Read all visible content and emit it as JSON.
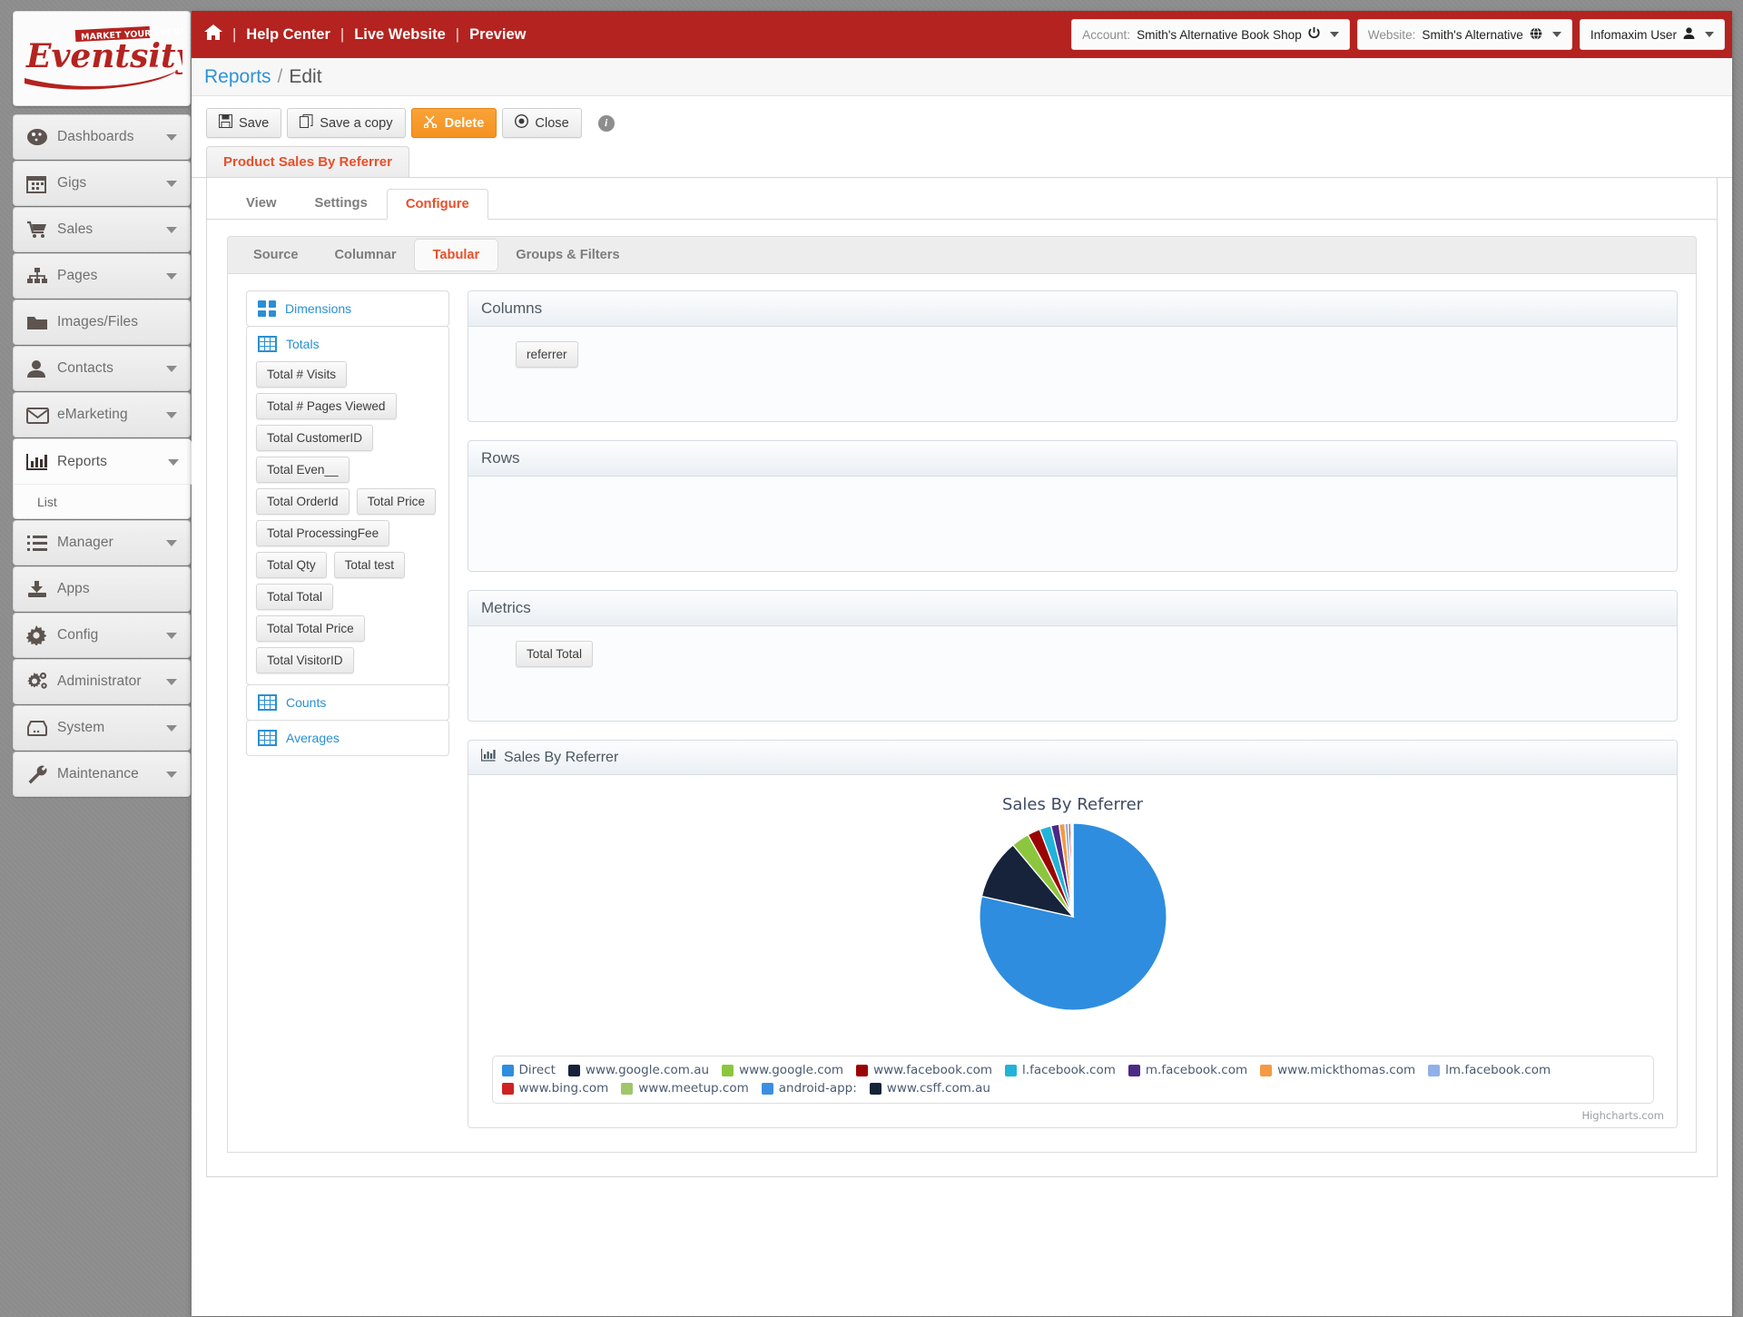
{
  "brand": {
    "logo_top": "MARKET YOUR EVENT",
    "logo_main": "Eventsity",
    "accent": "#b4231f"
  },
  "topbar": {
    "home_icon": "home-icon",
    "links": [
      "Help Center",
      "Live Website",
      "Preview"
    ],
    "separator": "|",
    "account": {
      "label": "Account:",
      "value": "Smith's Alternative Book Shop"
    },
    "website": {
      "label": "Website:",
      "value": "Smith's Alternative"
    },
    "user": {
      "value": "Infomaxim User"
    }
  },
  "breadcrumb": {
    "root": "Reports",
    "separator": "/",
    "current": "Edit"
  },
  "toolbar": {
    "save": "Save",
    "save_copy": "Save a copy",
    "delete": "Delete",
    "close": "Close",
    "info": "i",
    "delete_color": "#f59220"
  },
  "report_tab": {
    "label": "Product Sales By Referrer",
    "color": "#e8502a"
  },
  "sub_tabs": [
    {
      "label": "View",
      "active": false
    },
    {
      "label": "Settings",
      "active": false
    },
    {
      "label": "Configure",
      "active": true
    }
  ],
  "inner_tabs": [
    {
      "label": "Source",
      "active": false
    },
    {
      "label": "Columnar",
      "active": false
    },
    {
      "label": "Tabular",
      "active": true
    },
    {
      "label": "Groups & Filters",
      "active": false
    }
  ],
  "sidebar": {
    "items": [
      {
        "label": "Dashboards",
        "icon": "dashboard-icon",
        "caret": true
      },
      {
        "label": "Gigs",
        "icon": "calendar-icon",
        "caret": true
      },
      {
        "label": "Sales",
        "icon": "cart-icon",
        "caret": true
      },
      {
        "label": "Pages",
        "icon": "sitemap-icon",
        "caret": true
      },
      {
        "label": "Images/Files",
        "icon": "folder-icon",
        "caret": false
      },
      {
        "label": "Contacts",
        "icon": "user-icon",
        "caret": true
      },
      {
        "label": "eMarketing",
        "icon": "envelope-icon",
        "caret": true
      },
      {
        "label": "Reports",
        "icon": "bar-chart-icon",
        "caret": true,
        "active": true,
        "children": [
          "List"
        ]
      },
      {
        "label": "Manager",
        "icon": "list-icon",
        "caret": true
      },
      {
        "label": "Apps",
        "icon": "download-icon",
        "caret": false
      },
      {
        "label": "Config",
        "icon": "gear-icon",
        "caret": true
      },
      {
        "label": "Administrator",
        "icon": "gears-icon",
        "caret": true
      },
      {
        "label": "System",
        "icon": "server-icon",
        "caret": true
      },
      {
        "label": "Maintenance",
        "icon": "wrench-icon",
        "caret": true
      }
    ]
  },
  "field_groups": [
    {
      "title": "Dimensions",
      "icon": "grid-icon",
      "fields": []
    },
    {
      "title": "Totals",
      "icon": "table-icon",
      "fields": [
        "Total # Visits",
        "Total # Pages Viewed",
        "Total CustomerID",
        "Total Even__",
        "Total OrderId",
        "Total Price",
        "Total ProcessingFee",
        "Total Qty",
        "Total test",
        "Total Total",
        "Total Total Price",
        "Total VisitorID"
      ]
    },
    {
      "title": "Counts",
      "icon": "table-icon",
      "fields": []
    },
    {
      "title": "Averages",
      "icon": "table-icon",
      "fields": []
    }
  ],
  "dropzones": [
    {
      "title": "Columns",
      "items": [
        "referrer"
      ]
    },
    {
      "title": "Rows",
      "items": []
    },
    {
      "title": "Metrics",
      "items": [
        "Total Total"
      ]
    }
  ],
  "chart_panel": {
    "header": "Sales By Referrer",
    "icon": "bar-chart-icon",
    "credits": "Highcharts.com"
  },
  "chart_data": {
    "type": "pie",
    "title": "Sales By Referrer",
    "xlabel": "",
    "ylabel": "",
    "legend_position": "bottom",
    "grid": false,
    "categories": [
      "Direct",
      "www.google.com.au",
      "www.google.com",
      "www.facebook.com",
      "l.facebook.com",
      "m.facebook.com",
      "www.mickthomas.com",
      "lm.facebook.com",
      "www.bing.com",
      "www.meetup.com",
      "android-app:",
      "www.csff.com.au"
    ],
    "values": [
      78.5,
      10.4,
      3.1,
      2.2,
      2.0,
      1.4,
      1.0,
      0.6,
      0.4,
      0.2,
      0.12,
      0.08
    ],
    "colors": [
      "#2e8ddf",
      "#16233b",
      "#8cc63e",
      "#9b0404",
      "#22b3d8",
      "#4b2a86",
      "#f59942",
      "#8fb0e8",
      "#cf2222",
      "#9fc66a",
      "#3c8fe0",
      "#16233b"
    ]
  }
}
